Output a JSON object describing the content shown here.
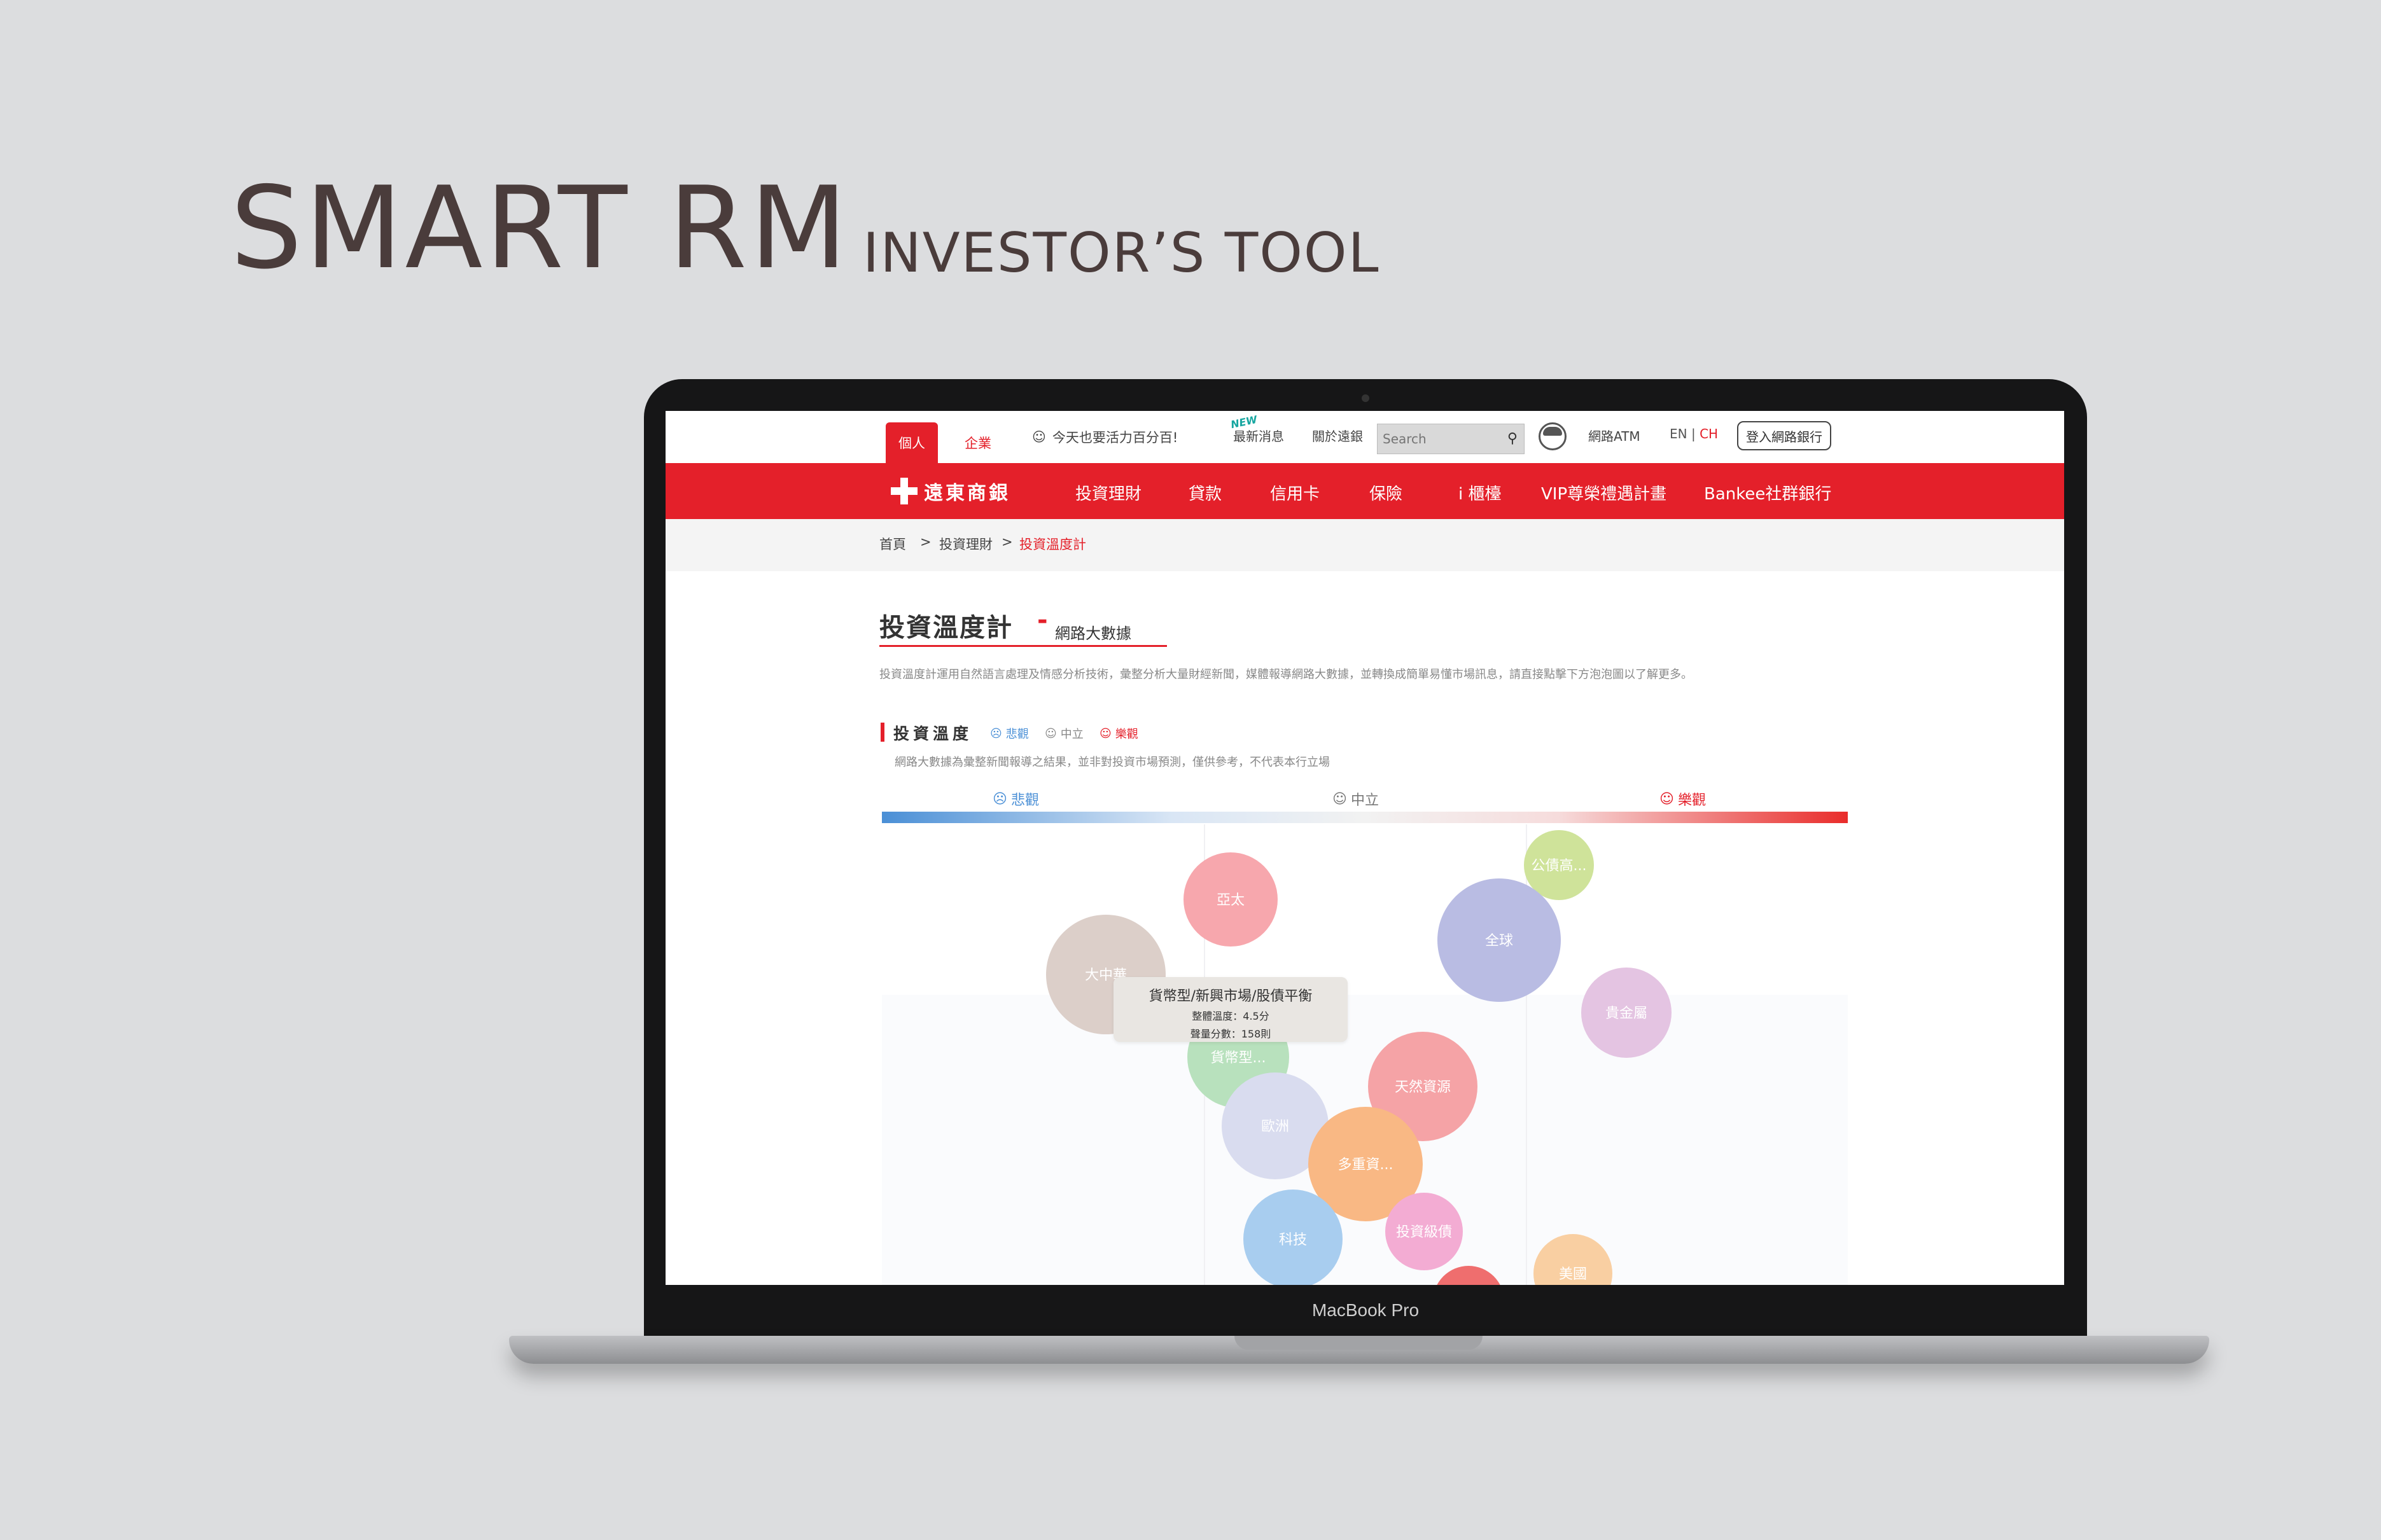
{
  "hero": {
    "title": "SMART RM",
    "subtitle": "INVESTOR’S TOOL"
  },
  "laptop": {
    "label": "MacBook Pro"
  },
  "topbar": {
    "tab_personal": "個人",
    "tab_corporate": "企業",
    "slogan": "今天也要活力百分百!",
    "new_tag": "NEW",
    "news_link": "最新消息",
    "about_link": "關於遠銀",
    "search_placeholder": "Search",
    "atm_link": "網路ATM",
    "lang_en": "EN",
    "lang_sep": "|",
    "lang_ch": "CH",
    "login_button": "登入網路銀行"
  },
  "nav": {
    "logo_text": "遠東商銀",
    "items": [
      "投資理財",
      "貸款",
      "信用卡",
      "保險",
      "i 櫃檯",
      "VIP尊榮禮遇計畫",
      "Bankee社群銀行"
    ]
  },
  "breadcrumb": {
    "home": "首頁",
    "sep": ">",
    "level1": "投資理財",
    "current": "投資溫度計"
  },
  "page": {
    "title": "投資溫度計",
    "dash": "-",
    "subtitle": "網路大數據",
    "description": "投資溫度計運用自然語言處理及情感分析技術，彙整分析大量財經新聞，媒體報導網路大數據，並轉換成簡單易懂市場訊息，請直接點擊下方泡泡圖以了解更多。"
  },
  "section": {
    "title": "投資溫度",
    "legend_pessimistic": "悲觀",
    "legend_neutral": "中立",
    "legend_optimistic": "樂觀",
    "note": "網路大數據為彙整新聞報導之結果，並非對投資市場預測，僅供參考，不代表本行立場"
  },
  "scale": {
    "pessimistic": "悲觀",
    "neutral": "中立",
    "optimistic": "樂觀"
  },
  "colors": {
    "brand_red": "#e4202a",
    "pessimistic_blue": "#4a8fd6",
    "optimistic_red": "#e92c2a"
  },
  "bubbles": [
    {
      "label": "亞太",
      "color": "#f7a7ad"
    },
    {
      "label": "公債高...",
      "color": "#cfe39a"
    },
    {
      "label": "全球",
      "color": "#b9bce3"
    },
    {
      "label": "大中華",
      "color": "#dccfc9"
    },
    {
      "label": "貴金屬",
      "color": "#e4c4e2"
    },
    {
      "label": "貨幣型...",
      "color": "#b8e1bd"
    },
    {
      "label": "天然資源",
      "color": "#f5a3a6"
    },
    {
      "label": "歐洲",
      "color": "#d9dcef"
    },
    {
      "label": "多重資...",
      "color": "#f9b884"
    },
    {
      "label": "科技",
      "color": "#a8cdef"
    },
    {
      "label": "投資級債",
      "color": "#f3acd3"
    },
    {
      "label": "美國",
      "color": "#f9cfa2"
    },
    {
      "label": "",
      "color": "#ef6e6e"
    }
  ],
  "tooltip": {
    "title": "貨幣型/新興市場/股債平衡",
    "temperature": "整體溫度：4.5分",
    "volume": "聲量分數：158則"
  }
}
